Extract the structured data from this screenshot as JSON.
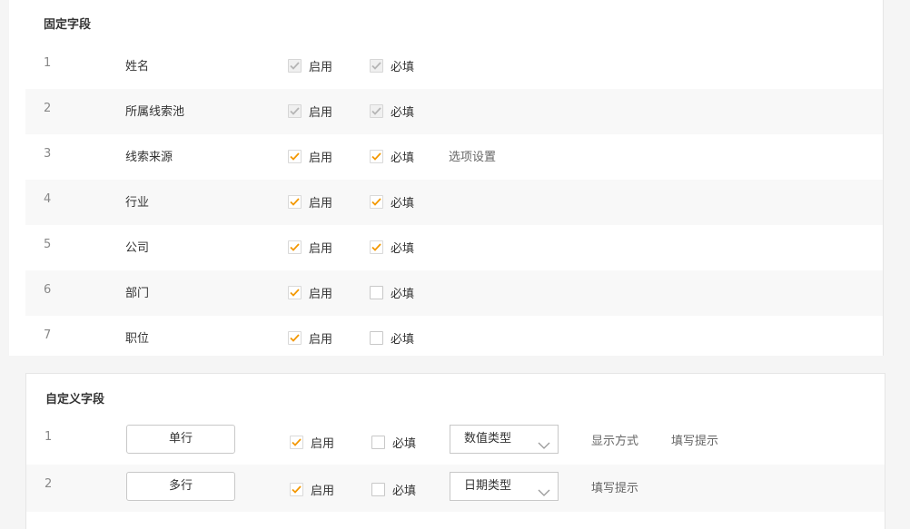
{
  "fixed": {
    "title": "固定字段",
    "enable_label": "启用",
    "required_label": "必填",
    "rows": [
      {
        "index": "1",
        "name": "姓名",
        "enabled": true,
        "required": true,
        "locked": true,
        "link": ""
      },
      {
        "index": "2",
        "name": "所属线索池",
        "enabled": true,
        "required": true,
        "locked": true,
        "link": ""
      },
      {
        "index": "3",
        "name": "线索来源",
        "enabled": true,
        "required": true,
        "locked": false,
        "link": "选项设置"
      },
      {
        "index": "4",
        "name": "行业",
        "enabled": true,
        "required": true,
        "locked": false,
        "link": ""
      },
      {
        "index": "5",
        "name": "公司",
        "enabled": true,
        "required": true,
        "locked": false,
        "link": ""
      },
      {
        "index": "6",
        "name": "部门",
        "enabled": true,
        "required": false,
        "locked": false,
        "link": ""
      },
      {
        "index": "7",
        "name": "职位",
        "enabled": true,
        "required": false,
        "locked": false,
        "link": ""
      }
    ]
  },
  "custom": {
    "title": "自定义字段",
    "enable_label": "启用",
    "required_label": "必填",
    "rows": [
      {
        "index": "1",
        "type_button": "单行",
        "enabled": true,
        "required": false,
        "select_value": "数值类型",
        "links": [
          "显示方式",
          "填写提示"
        ]
      },
      {
        "index": "2",
        "type_button": "多行",
        "enabled": true,
        "required": false,
        "select_value": "日期类型",
        "links": [
          "填写提示"
        ]
      }
    ]
  },
  "colors": {
    "accent": "#f39800",
    "disabled_check": "#b5b5b5",
    "row_alt": "#f8f8f8"
  },
  "icons": {
    "check": "check-icon",
    "dropdown": "chevron-down-icon"
  }
}
